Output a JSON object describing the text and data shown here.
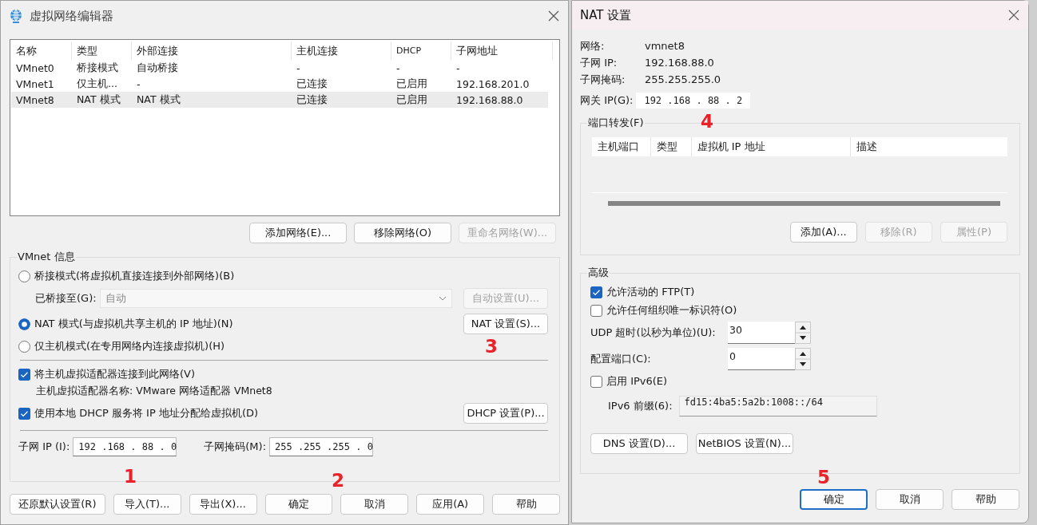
{
  "editor": {
    "title": "虚拟网络编辑器",
    "table": {
      "columns": [
        "名称",
        "类型",
        "外部连接",
        "主机连接",
        "DHCP",
        "子网地址"
      ],
      "rows": [
        {
          "cells": [
            "VMnet0",
            "桥接模式",
            "自动桥接",
            "-",
            "-",
            "-"
          ],
          "selected": false
        },
        {
          "cells": [
            "VMnet1",
            "仅主机...",
            "-",
            "已连接",
            "已启用",
            "192.168.201.0"
          ],
          "selected": false
        },
        {
          "cells": [
            "VMnet8",
            "NAT 模式",
            "NAT 模式",
            "已连接",
            "已启用",
            "192.168.88.0"
          ],
          "selected": true
        }
      ]
    },
    "list_buttons": [
      {
        "label": "添加网络(E)...",
        "disabled": false
      },
      {
        "label": "移除网络(O)",
        "disabled": false
      },
      {
        "label": "重命名网络(W)...",
        "disabled": true
      }
    ],
    "info": {
      "title": "VMnet 信息",
      "modes": [
        {
          "label": "桥接模式(将虚拟机直接连接到外部网络)(B)",
          "selected": false
        },
        {
          "label": "NAT 模式(与虚拟机共享主机的 IP 地址)(N)",
          "selected": true
        },
        {
          "label": "仅主机模式(在专用网络内连接虚拟机)(H)",
          "selected": false
        }
      ],
      "bridged_to": {
        "label": "已桥接至(G):",
        "value": "自动",
        "disabled": true
      },
      "auto_button": {
        "label": "自动设置(U)...",
        "disabled": true
      },
      "nat_button": {
        "label": "NAT 设置(S)...",
        "disabled": false
      },
      "host_adapter": {
        "label": "将主机虚拟适配器连接到此网络(V)",
        "checked": true
      },
      "adapter_name": "主机虚拟适配器名称: VMware 网络适配器 VMnet8",
      "dhcp": {
        "label": "使用本地 DHCP 服务将 IP 地址分配给虚拟机(D)",
        "checked": true
      },
      "dhcp_button": {
        "label": "DHCP 设置(P)...",
        "disabled": false
      },
      "subnet_ip": {
        "label": "子网 IP (I):",
        "value": "192 .168 . 88 . 0"
      },
      "subnet_mask": {
        "label": "子网掩码(M):",
        "value": "255 .255 .255 . 0"
      }
    },
    "footer_buttons": [
      {
        "label": "还原默认设置(R)",
        "disabled": false
      },
      {
        "label": "导入(T)...",
        "disabled": false
      },
      {
        "label": "导出(X)...",
        "disabled": false
      },
      {
        "label": "确定",
        "disabled": false
      },
      {
        "label": "取消",
        "disabled": false
      },
      {
        "label": "应用(A)",
        "disabled": false
      },
      {
        "label": "帮助",
        "disabled": false
      }
    ]
  },
  "nat": {
    "title": "NAT 设置",
    "info": [
      {
        "label": "网络:",
        "value": "vmnet8"
      },
      {
        "label": "子网 IP:",
        "value": "192.168.88.0"
      },
      {
        "label": "子网掩码:",
        "value": "255.255.255.0"
      }
    ],
    "gateway": {
      "label": "网关 IP(G):",
      "value": "192 .168 . 88 . 2"
    },
    "port_forwarding": {
      "title": "端口转发(F)",
      "columns": [
        "主机端口",
        "类型",
        "虚拟机 IP 地址",
        "描述"
      ],
      "buttons": [
        {
          "label": "添加(A)...",
          "disabled": false
        },
        {
          "label": "移除(R)",
          "disabled": true
        },
        {
          "label": "属性(P)",
          "disabled": true
        }
      ]
    },
    "advanced": {
      "title": "高级",
      "checks": [
        {
          "label": "允许活动的 FTP(T)",
          "checked": true
        },
        {
          "label": "允许任何组织唯一标识符(O)",
          "checked": false
        }
      ],
      "udp_timeout": {
        "label": "UDP 超时(以秒为单位)(U):",
        "value": "30"
      },
      "config_port": {
        "label": "配置端口(C):",
        "value": "0"
      },
      "ipv6": {
        "label": "启用 IPv6(E)",
        "checked": false
      },
      "ipv6_prefix": {
        "label": "IPv6 前缀(6):",
        "value": "fd15:4ba5:5a2b:1008::/64",
        "disabled": true
      },
      "buttons": [
        {
          "label": "DNS 设置(D)...",
          "disabled": false
        },
        {
          "label": "NetBIOS 设置(N)...",
          "disabled": false
        }
      ]
    },
    "footer_buttons": [
      {
        "label": "确定",
        "default": true
      },
      {
        "label": "取消",
        "default": false
      },
      {
        "label": "帮助",
        "default": false
      }
    ]
  },
  "annotations": [
    "1",
    "2",
    "3",
    "4",
    "5"
  ]
}
